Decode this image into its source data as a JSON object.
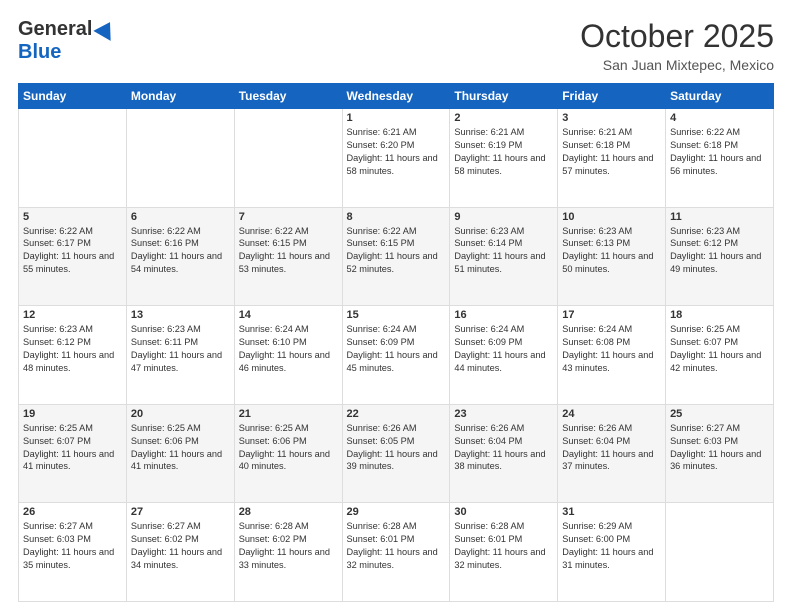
{
  "header": {
    "logo_general": "General",
    "logo_blue": "Blue",
    "month_title": "October 2025",
    "location": "San Juan Mixtepec, Mexico"
  },
  "days_of_week": [
    "Sunday",
    "Monday",
    "Tuesday",
    "Wednesday",
    "Thursday",
    "Friday",
    "Saturday"
  ],
  "weeks": [
    [
      {
        "day": "",
        "sunrise": "",
        "sunset": "",
        "daylight": "",
        "empty": true
      },
      {
        "day": "",
        "sunrise": "",
        "sunset": "",
        "daylight": "",
        "empty": true
      },
      {
        "day": "",
        "sunrise": "",
        "sunset": "",
        "daylight": "",
        "empty": true
      },
      {
        "day": "1",
        "sunrise": "Sunrise: 6:21 AM",
        "sunset": "Sunset: 6:20 PM",
        "daylight": "Daylight: 11 hours and 58 minutes."
      },
      {
        "day": "2",
        "sunrise": "Sunrise: 6:21 AM",
        "sunset": "Sunset: 6:19 PM",
        "daylight": "Daylight: 11 hours and 58 minutes."
      },
      {
        "day": "3",
        "sunrise": "Sunrise: 6:21 AM",
        "sunset": "Sunset: 6:18 PM",
        "daylight": "Daylight: 11 hours and 57 minutes."
      },
      {
        "day": "4",
        "sunrise": "Sunrise: 6:22 AM",
        "sunset": "Sunset: 6:18 PM",
        "daylight": "Daylight: 11 hours and 56 minutes."
      }
    ],
    [
      {
        "day": "5",
        "sunrise": "Sunrise: 6:22 AM",
        "sunset": "Sunset: 6:17 PM",
        "daylight": "Daylight: 11 hours and 55 minutes."
      },
      {
        "day": "6",
        "sunrise": "Sunrise: 6:22 AM",
        "sunset": "Sunset: 6:16 PM",
        "daylight": "Daylight: 11 hours and 54 minutes."
      },
      {
        "day": "7",
        "sunrise": "Sunrise: 6:22 AM",
        "sunset": "Sunset: 6:15 PM",
        "daylight": "Daylight: 11 hours and 53 minutes."
      },
      {
        "day": "8",
        "sunrise": "Sunrise: 6:22 AM",
        "sunset": "Sunset: 6:15 PM",
        "daylight": "Daylight: 11 hours and 52 minutes."
      },
      {
        "day": "9",
        "sunrise": "Sunrise: 6:23 AM",
        "sunset": "Sunset: 6:14 PM",
        "daylight": "Daylight: 11 hours and 51 minutes."
      },
      {
        "day": "10",
        "sunrise": "Sunrise: 6:23 AM",
        "sunset": "Sunset: 6:13 PM",
        "daylight": "Daylight: 11 hours and 50 minutes."
      },
      {
        "day": "11",
        "sunrise": "Sunrise: 6:23 AM",
        "sunset": "Sunset: 6:12 PM",
        "daylight": "Daylight: 11 hours and 49 minutes."
      }
    ],
    [
      {
        "day": "12",
        "sunrise": "Sunrise: 6:23 AM",
        "sunset": "Sunset: 6:12 PM",
        "daylight": "Daylight: 11 hours and 48 minutes."
      },
      {
        "day": "13",
        "sunrise": "Sunrise: 6:23 AM",
        "sunset": "Sunset: 6:11 PM",
        "daylight": "Daylight: 11 hours and 47 minutes."
      },
      {
        "day": "14",
        "sunrise": "Sunrise: 6:24 AM",
        "sunset": "Sunset: 6:10 PM",
        "daylight": "Daylight: 11 hours and 46 minutes."
      },
      {
        "day": "15",
        "sunrise": "Sunrise: 6:24 AM",
        "sunset": "Sunset: 6:09 PM",
        "daylight": "Daylight: 11 hours and 45 minutes."
      },
      {
        "day": "16",
        "sunrise": "Sunrise: 6:24 AM",
        "sunset": "Sunset: 6:09 PM",
        "daylight": "Daylight: 11 hours and 44 minutes."
      },
      {
        "day": "17",
        "sunrise": "Sunrise: 6:24 AM",
        "sunset": "Sunset: 6:08 PM",
        "daylight": "Daylight: 11 hours and 43 minutes."
      },
      {
        "day": "18",
        "sunrise": "Sunrise: 6:25 AM",
        "sunset": "Sunset: 6:07 PM",
        "daylight": "Daylight: 11 hours and 42 minutes."
      }
    ],
    [
      {
        "day": "19",
        "sunrise": "Sunrise: 6:25 AM",
        "sunset": "Sunset: 6:07 PM",
        "daylight": "Daylight: 11 hours and 41 minutes."
      },
      {
        "day": "20",
        "sunrise": "Sunrise: 6:25 AM",
        "sunset": "Sunset: 6:06 PM",
        "daylight": "Daylight: 11 hours and 41 minutes."
      },
      {
        "day": "21",
        "sunrise": "Sunrise: 6:25 AM",
        "sunset": "Sunset: 6:06 PM",
        "daylight": "Daylight: 11 hours and 40 minutes."
      },
      {
        "day": "22",
        "sunrise": "Sunrise: 6:26 AM",
        "sunset": "Sunset: 6:05 PM",
        "daylight": "Daylight: 11 hours and 39 minutes."
      },
      {
        "day": "23",
        "sunrise": "Sunrise: 6:26 AM",
        "sunset": "Sunset: 6:04 PM",
        "daylight": "Daylight: 11 hours and 38 minutes."
      },
      {
        "day": "24",
        "sunrise": "Sunrise: 6:26 AM",
        "sunset": "Sunset: 6:04 PM",
        "daylight": "Daylight: 11 hours and 37 minutes."
      },
      {
        "day": "25",
        "sunrise": "Sunrise: 6:27 AM",
        "sunset": "Sunset: 6:03 PM",
        "daylight": "Daylight: 11 hours and 36 minutes."
      }
    ],
    [
      {
        "day": "26",
        "sunrise": "Sunrise: 6:27 AM",
        "sunset": "Sunset: 6:03 PM",
        "daylight": "Daylight: 11 hours and 35 minutes."
      },
      {
        "day": "27",
        "sunrise": "Sunrise: 6:27 AM",
        "sunset": "Sunset: 6:02 PM",
        "daylight": "Daylight: 11 hours and 34 minutes."
      },
      {
        "day": "28",
        "sunrise": "Sunrise: 6:28 AM",
        "sunset": "Sunset: 6:02 PM",
        "daylight": "Daylight: 11 hours and 33 minutes."
      },
      {
        "day": "29",
        "sunrise": "Sunrise: 6:28 AM",
        "sunset": "Sunset: 6:01 PM",
        "daylight": "Daylight: 11 hours and 32 minutes."
      },
      {
        "day": "30",
        "sunrise": "Sunrise: 6:28 AM",
        "sunset": "Sunset: 6:01 PM",
        "daylight": "Daylight: 11 hours and 32 minutes."
      },
      {
        "day": "31",
        "sunrise": "Sunrise: 6:29 AM",
        "sunset": "Sunset: 6:00 PM",
        "daylight": "Daylight: 11 hours and 31 minutes."
      },
      {
        "day": "",
        "sunrise": "",
        "sunset": "",
        "daylight": "",
        "empty": true
      }
    ]
  ]
}
